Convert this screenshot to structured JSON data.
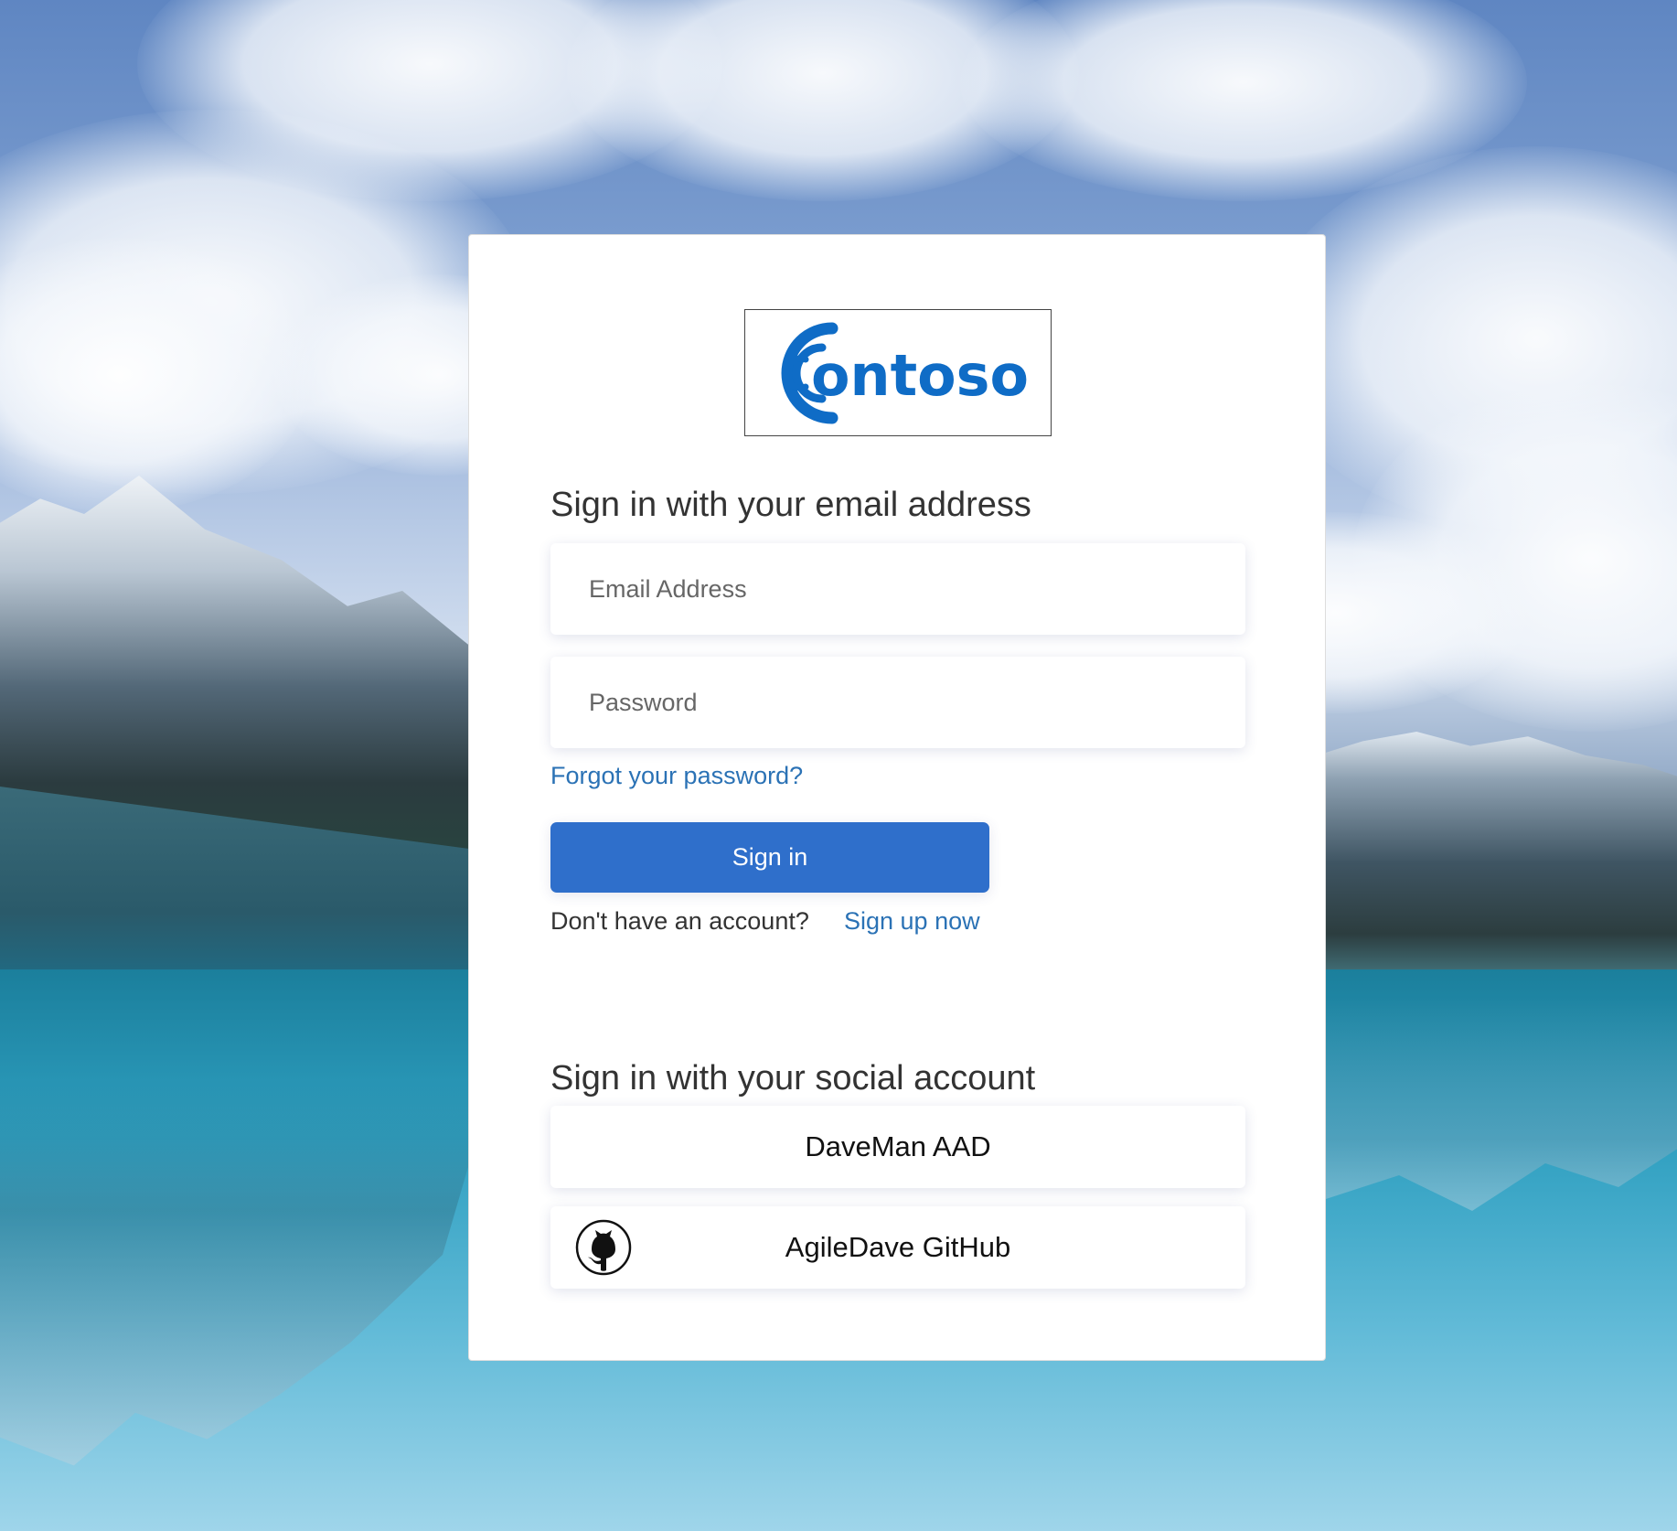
{
  "logo": {
    "brand_text": "ontoso",
    "brand_color": "#0f6cc6"
  },
  "local_signin": {
    "heading": "Sign in with your email address",
    "email_placeholder": "Email Address",
    "password_placeholder": "Password",
    "forgot_password": "Forgot your password?",
    "submit_label": "Sign in",
    "no_account_text": "Don't have an account?",
    "signup_link": "Sign up now"
  },
  "social_signin": {
    "heading": "Sign in with your social account",
    "providers": [
      {
        "label": "DaveMan AAD",
        "icon": ""
      },
      {
        "label": "AgileDave GitHub",
        "icon": "github-icon"
      }
    ]
  },
  "colors": {
    "primary_button": "#2f6fcb",
    "link": "#2b72b5",
    "heading_text": "#333333"
  }
}
